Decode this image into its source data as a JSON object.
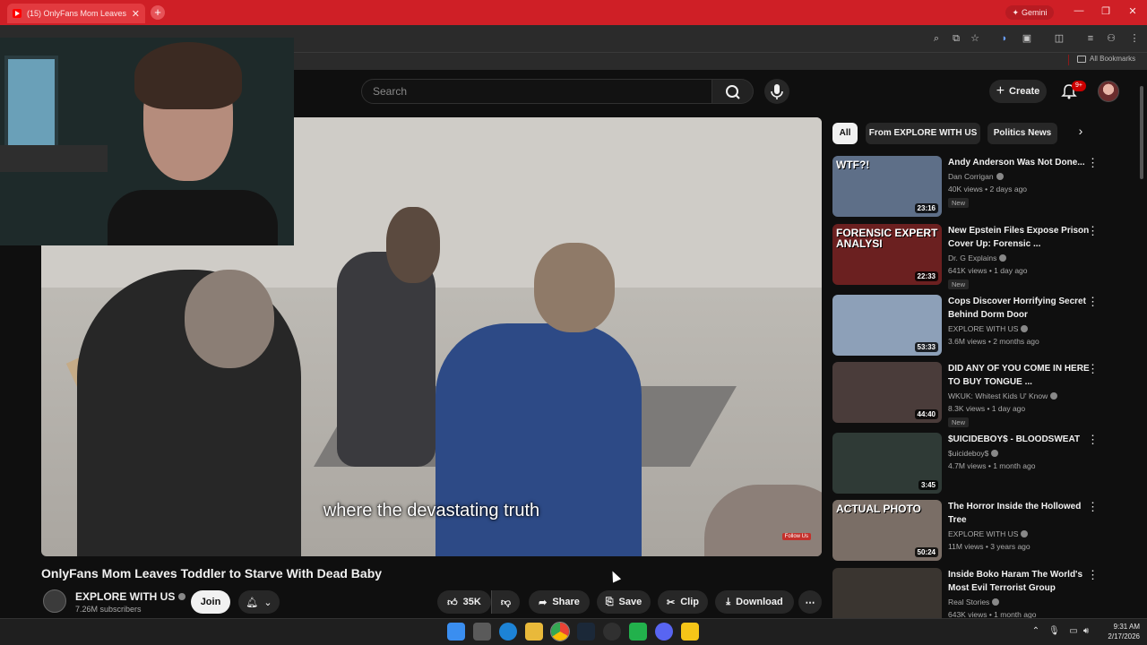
{
  "browser": {
    "tab_title": "(15) OnlyFans Mom Leaves",
    "new_tab_label": "+",
    "gemini_label": "Gemini",
    "all_bookmarks_label": "All Bookmarks"
  },
  "header": {
    "search_placeholder": "Search",
    "create_label": "Create",
    "notifications_badge": "9+"
  },
  "player": {
    "subtitle": "where the devastating truth",
    "watermark": "Follow Us"
  },
  "video": {
    "title": "OnlyFans Mom Leaves Toddler to Starve With Dead Baby",
    "channel_name": "EXPLORE WITH US",
    "subscribers": "7.26M subscribers",
    "join_label": "Join",
    "like_count": "35K",
    "share_label": "Share",
    "save_label": "Save",
    "clip_label": "Clip",
    "download_label": "Download"
  },
  "chips": [
    {
      "label": "All",
      "active": true
    },
    {
      "label": "From EXPLORE WITH US",
      "active": false
    },
    {
      "label": "Politics News",
      "active": false
    }
  ],
  "recommendations": [
    {
      "title": "Andy Anderson Was Not Done...",
      "channel": "Dan Corrigan",
      "meta": "40K views • 2 days ago",
      "duration": "23:16",
      "new": "New",
      "thumb_color": "#5e6f88",
      "thumb_text": "WTF?!"
    },
    {
      "title": "New Epstein Files Expose Prison Cover Up: Forensic ...",
      "channel": "Dr. G Explains",
      "meta": "641K views • 1 day ago",
      "duration": "22:33",
      "new": "New",
      "thumb_color": "#6b2020",
      "thumb_text": "FORENSIC EXPERT ANALYSI"
    },
    {
      "title": "Cops Discover Horrifying Secret Behind Dorm Door",
      "channel": "EXPLORE WITH US",
      "meta": "3.6M views • 2 months ago",
      "duration": "53:33",
      "new": "",
      "thumb_color": "#8da0b8",
      "thumb_text": ""
    },
    {
      "title": "DID ANY OF YOU COME IN HERE TO BUY TONGUE ...",
      "channel": "WKUK: Whitest Kids U' Know",
      "meta": "8.3K views • 1 day ago",
      "duration": "44:40",
      "new": "New",
      "thumb_color": "#4a3c3a",
      "thumb_text": ""
    },
    {
      "title": "$UICIDEBOY$ - BLOODSWEAT",
      "channel": "$uicideboy$",
      "meta": "4.7M views • 1 month ago",
      "duration": "3:45",
      "new": "",
      "thumb_color": "#2f3a36",
      "thumb_text": ""
    },
    {
      "title": "The Horror Inside the Hollowed Tree",
      "channel": "EXPLORE WITH US",
      "meta": "11M views • 3 years ago",
      "duration": "50:24",
      "new": "",
      "thumb_color": "#7a6e66",
      "thumb_text": "ACTUAL PHOTO"
    },
    {
      "title": "Inside Boko Haram The World's Most Evil Terrorist Group",
      "channel": "Real Stories",
      "meta": "643K views • 1 month ago",
      "duration": "",
      "new": "",
      "thumb_color": "#3a3530",
      "thumb_text": ""
    }
  ],
  "taskbar": {
    "time": "9:31 AM",
    "date": "2/17/2026"
  }
}
